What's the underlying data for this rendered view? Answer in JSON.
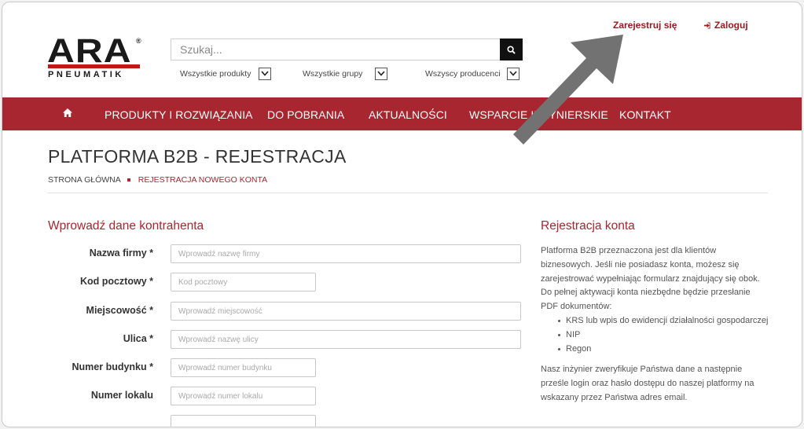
{
  "header": {
    "logo": {
      "brand": "ARA",
      "registered": "®",
      "sub": "PNEUMATIK"
    },
    "search": {
      "placeholder": "Szukaj..."
    },
    "filters": [
      {
        "label": "Wszystkie produkty"
      },
      {
        "label": "Wszystkie grupy"
      },
      {
        "label": "Wszyscy producenci"
      }
    ],
    "register_link": "Zarejestruj się",
    "login_link": "Zaloguj"
  },
  "nav": {
    "items": [
      "PRODUKTY I ROZWIĄZANIA",
      "DO POBRANIA",
      "AKTUALNOŚCI",
      "WSPARCIE INŻYNIERSKIE",
      "KONTAKT"
    ]
  },
  "page": {
    "title": "PLATFORMA B2B - REJESTRACJA",
    "breadcrumb": {
      "home": "STRONA GŁÓWNA",
      "current": "REJESTRACJA NOWEGO KONTA"
    }
  },
  "form": {
    "section_title": "Wprowadź dane kontrahenta",
    "fields": [
      {
        "label": "Nazwa firmy *",
        "placeholder": "Wprowadź nazwę firmy",
        "value": ""
      },
      {
        "label": "Kod pocztowy *",
        "placeholder": "Kod pocztowy",
        "value": ""
      },
      {
        "label": "Miejscowość *",
        "placeholder": "Wprowadź miejscowość",
        "value": ""
      },
      {
        "label": "Ulica *",
        "placeholder": "Wprowadź nazwę ulicy",
        "value": ""
      },
      {
        "label": "Numer budynku *",
        "placeholder": "Wprowadź numer budynku",
        "value": ""
      },
      {
        "label": "Numer lokalu",
        "placeholder": "Wprowadź numer lokalu",
        "value": ""
      }
    ]
  },
  "info": {
    "title": "Rejestracja konta",
    "intro": "Platforma B2B przeznaczona jest dla klientów biznesowych. Jeśli nie posiadasz konta, możesz się zarejestrować wypełniając formularz znajdujący się obok. Do pełnej aktywacji konta niezbędne będzie przesłanie PDF dokumentów:",
    "documents": [
      "KRS lub wpis do ewidencji działalności gospodarczej",
      "NIP",
      "Regon"
    ],
    "outro": "Nasz inżynier zweryfikuje Państwa dane a następnie prześle login oraz hasło dostępu do naszej platformy na wskazany przez Państwa adres email."
  },
  "colors": {
    "brand_red": "#a8262f",
    "link_red": "#9b1c20",
    "arrow_gray": "#707070"
  }
}
